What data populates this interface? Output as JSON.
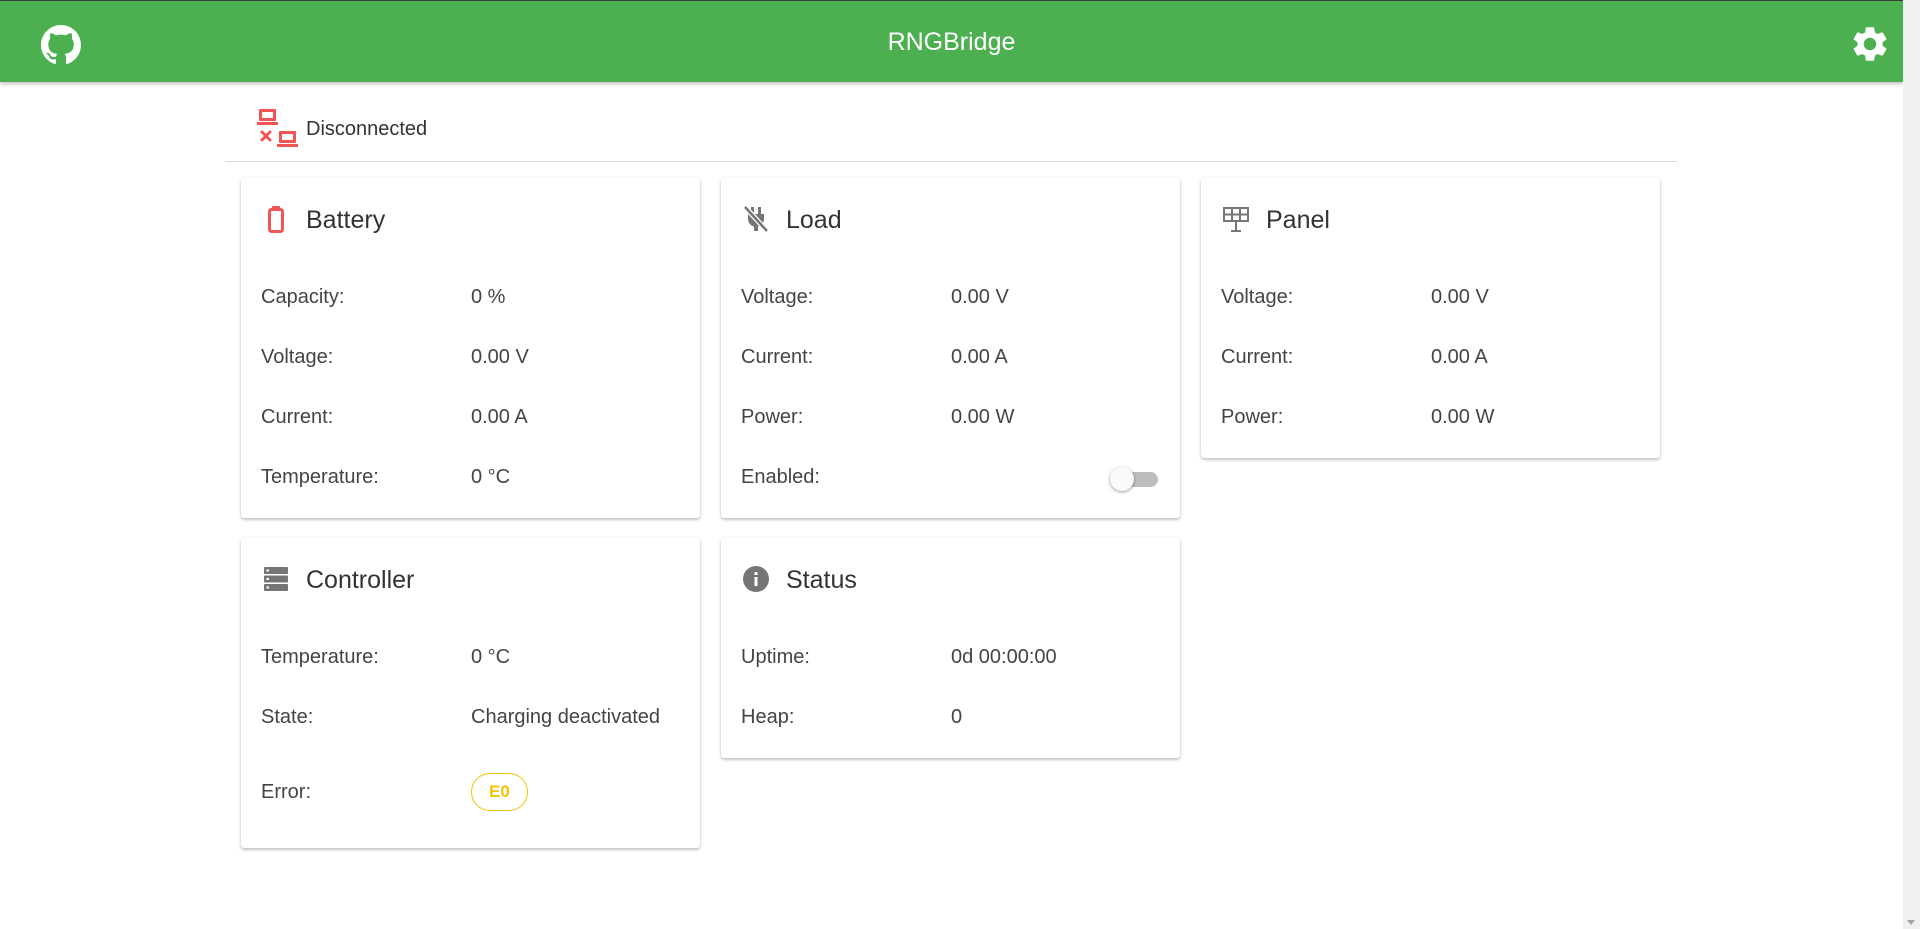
{
  "app": {
    "title": "RNGBridge"
  },
  "connection": {
    "status": "Disconnected"
  },
  "cards": {
    "battery": {
      "title": "Battery",
      "rows": [
        {
          "label": "Capacity:",
          "value": "0 %"
        },
        {
          "label": "Voltage:",
          "value": "0.00 V"
        },
        {
          "label": "Current:",
          "value": "0.00 A"
        },
        {
          "label": "Temperature:",
          "value": "0 °C"
        }
      ]
    },
    "load": {
      "title": "Load",
      "rows": [
        {
          "label": "Voltage:",
          "value": "0.00 V"
        },
        {
          "label": "Current:",
          "value": "0.00 A"
        },
        {
          "label": "Power:",
          "value": "0.00 W"
        },
        {
          "label": "Enabled:"
        }
      ],
      "enabled": false
    },
    "panel": {
      "title": "Panel",
      "rows": [
        {
          "label": "Voltage:",
          "value": "0.00 V"
        },
        {
          "label": "Current:",
          "value": "0.00 A"
        },
        {
          "label": "Power:",
          "value": "0.00 W"
        }
      ]
    },
    "controller": {
      "title": "Controller",
      "rows": [
        {
          "label": "Temperature:",
          "value": "0 °C"
        },
        {
          "label": "State:",
          "value": "Charging deactivated"
        },
        {
          "label": "Error:",
          "value": "E0"
        }
      ]
    },
    "status": {
      "title": "Status",
      "rows": [
        {
          "label": "Uptime:",
          "value": "0d 00:00:00"
        },
        {
          "label": "Heap:",
          "value": "0"
        }
      ]
    }
  },
  "icons": {
    "github": "github-icon",
    "settings": "gear-icon",
    "disconnected": "lan-disconnect-icon",
    "battery": "battery-alert-icon",
    "load": "power-plug-off-icon",
    "panel": "solar-panel-icon",
    "controller": "server-icon",
    "status": "information-icon"
  },
  "colors": {
    "appbar": "#4caf50",
    "alert": "#f05454",
    "error_chip": "#f2c200",
    "icon_grey": "#757575"
  }
}
